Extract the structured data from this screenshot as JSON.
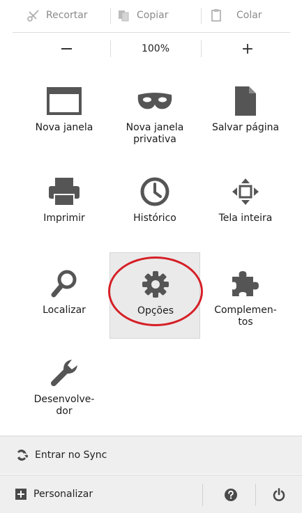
{
  "edit": {
    "cut": "Recortar",
    "copy": "Copiar",
    "paste": "Colar"
  },
  "zoom": {
    "minus": "−",
    "level": "100%",
    "plus": "+"
  },
  "tiles": [
    {
      "label": "Nova janela",
      "icon": "new-window-icon"
    },
    {
      "label": "Nova janela\nprivativa",
      "icon": "private-mask-icon"
    },
    {
      "label": "Salvar página",
      "icon": "save-page-icon"
    },
    {
      "label": "Imprimir",
      "icon": "printer-icon"
    },
    {
      "label": "Histórico",
      "icon": "history-clock-icon"
    },
    {
      "label": "Tela inteira",
      "icon": "fullscreen-icon"
    },
    {
      "label": "Localizar",
      "icon": "search-icon"
    },
    {
      "label": "Opções",
      "icon": "gear-icon"
    },
    {
      "label": "Complemen-\ntos",
      "icon": "puzzle-icon"
    },
    {
      "label": "Desenvolve-\ndor",
      "icon": "wrench-icon"
    }
  ],
  "footer": {
    "sync": "Entrar no Sync",
    "customize": "Personalizar"
  },
  "colors": {
    "icon": "#555555",
    "highlight_ring": "#d61f26",
    "footer_bg": "#efefef"
  }
}
